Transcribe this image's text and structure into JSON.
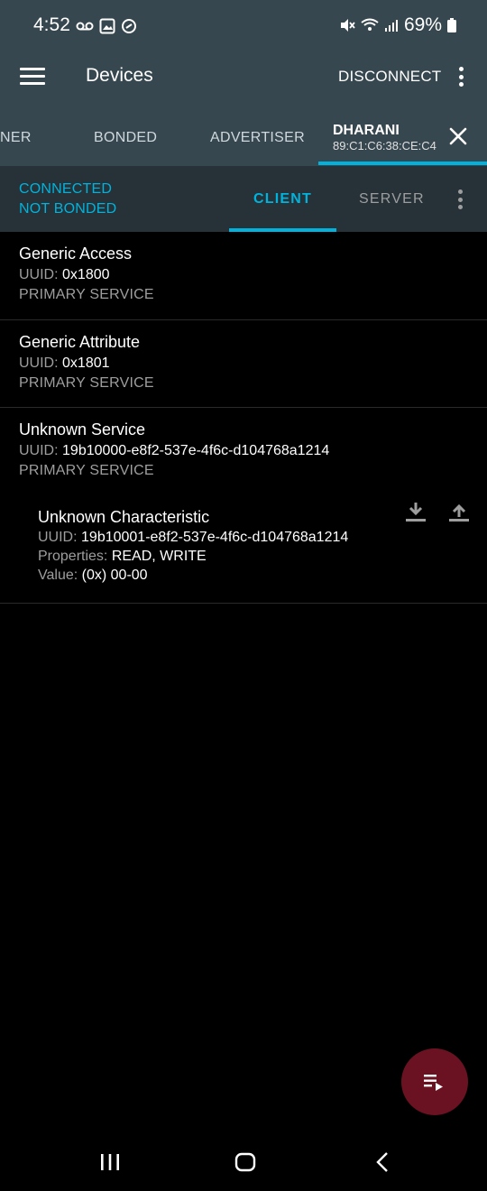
{
  "status_bar": {
    "time": "4:52",
    "battery": "69%",
    "icons": [
      "voicemail-icon",
      "image-icon",
      "link-icon",
      "mute-icon",
      "wifi-icon",
      "signal-icon",
      "battery-icon"
    ]
  },
  "app_bar": {
    "title": "Devices",
    "disconnect_label": "DISCONNECT"
  },
  "tabs": [
    {
      "label": "NER"
    },
    {
      "label": "BONDED"
    },
    {
      "label": "ADVERTISER"
    }
  ],
  "active_device": {
    "name": "DHARANI",
    "address": "89:C1:C6:38:CE:C4"
  },
  "connection": {
    "status": "CONNECTED",
    "bond": "NOT BONDED",
    "client_label": "CLIENT",
    "server_label": "SERVER"
  },
  "services": [
    {
      "name": "Generic Access",
      "uuid_label": "UUID:",
      "uuid": "0x1800",
      "type": "PRIMARY SERVICE"
    },
    {
      "name": "Generic Attribute",
      "uuid_label": "UUID:",
      "uuid": "0x1801",
      "type": "PRIMARY SERVICE"
    },
    {
      "name": "Unknown Service",
      "uuid_label": "UUID:",
      "uuid": "19b10000-e8f2-537e-4f6c-d104768a1214",
      "type": "PRIMARY SERVICE"
    }
  ],
  "characteristic": {
    "name": "Unknown Characteristic",
    "uuid_label": "UUID:",
    "uuid": "19b10001-e8f2-537e-4f6c-d104768a1214",
    "properties_label": "Properties:",
    "properties": "READ, WRITE",
    "value_label": "Value:",
    "value": "(0x) 00-00"
  },
  "colors": {
    "toolbar": "#37474f",
    "accent": "#00b3dc",
    "fab": "#6b1222"
  }
}
